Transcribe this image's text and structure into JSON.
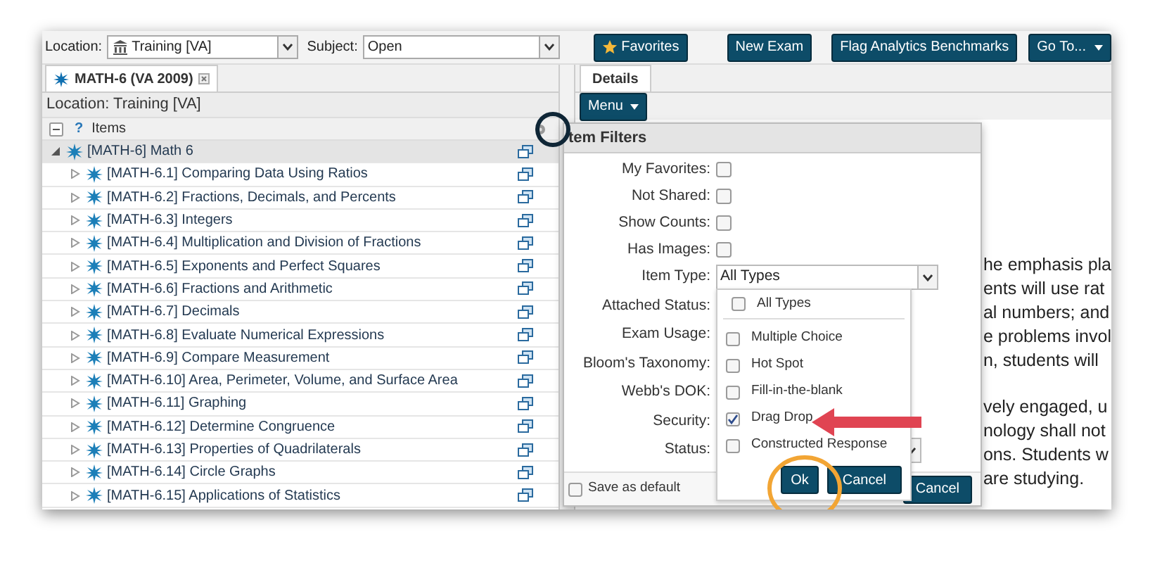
{
  "toolbar": {
    "location_label": "Location:",
    "location_value": "Training [VA]",
    "subject_label": "Subject:",
    "subject_value": "Open",
    "buttons": [
      {
        "label": "Favorites",
        "kind": "star"
      },
      {
        "label": "New Exam",
        "kind": "plain"
      },
      {
        "label": "Flag Analytics Benchmarks",
        "kind": "plain"
      },
      {
        "label": "Go To...",
        "kind": "menu"
      }
    ]
  },
  "left_tab": {
    "label": "MATH-6 (VA 2009)"
  },
  "location_text": "Location: Training [VA]",
  "items_header": {
    "help": "?",
    "label": "Items"
  },
  "tree": [
    {
      "label": "[MATH-6] Math 6",
      "expanded": true,
      "children": [
        {
          "label": "[MATH-6.1] Comparing Data Using Ratios",
          "expanded": false
        },
        {
          "label": "[MATH-6.2] Fractions, Decimals, and Percents",
          "expanded": false
        },
        {
          "label": "[MATH-6.3] Integers",
          "expanded": false
        },
        {
          "label": "[MATH-6.4] Multiplication and Division of Fractions",
          "expanded": false
        },
        {
          "label": "[MATH-6.5] Exponents and Perfect Squares",
          "expanded": false
        },
        {
          "label": "[MATH-6.6] Fractions and Arithmetic",
          "expanded": false
        },
        {
          "label": "[MATH-6.7] Decimals",
          "expanded": false
        },
        {
          "label": "[MATH-6.8] Evaluate Numerical Expressions",
          "expanded": false
        },
        {
          "label": "[MATH-6.9] Compare Measurement",
          "expanded": false
        },
        {
          "label": "[MATH-6.10] Area, Perimeter, Volume, and Surface Area",
          "expanded": false
        },
        {
          "label": "[MATH-6.11] Graphing",
          "expanded": false
        },
        {
          "label": "[MATH-6.12] Determine Congruence",
          "expanded": false
        },
        {
          "label": "[MATH-6.13] Properties of Quadrilaterals",
          "expanded": false
        },
        {
          "label": "[MATH-6.14] Circle Graphs",
          "expanded": false
        },
        {
          "label": "[MATH-6.15] Applications of Statistics",
          "expanded": false
        }
      ]
    }
  ],
  "right_tab": {
    "label": "Details"
  },
  "menu_button": "Menu",
  "details_paragraphs": [
    [
      "he emphasis pla",
      "ents will use rat",
      "al numbers; and",
      "e problems invol",
      "n, students will"
    ],
    [
      "vely engaged, u",
      "nology shall not",
      "ons. Students w",
      "are studying."
    ]
  ],
  "filters": {
    "title": "tem Filters",
    "fields": [
      {
        "label": "My Favorites:",
        "kind": "checkbox",
        "checked": false
      },
      {
        "label": "Not Shared:",
        "kind": "checkbox",
        "checked": false
      },
      {
        "label": "Show Counts:",
        "kind": "checkbox",
        "checked": false
      },
      {
        "label": "Has Images:",
        "kind": "checkbox",
        "checked": false
      },
      {
        "label": "Item Type:",
        "kind": "select",
        "value": "All Types"
      },
      {
        "label": "Attached Status:",
        "kind": "covered"
      },
      {
        "label": "Exam Usage:",
        "kind": "covered"
      },
      {
        "label": "Bloom's Taxonomy:",
        "kind": "covered"
      },
      {
        "label": "Webb's DOK:",
        "kind": "covered"
      },
      {
        "label": "Security:",
        "kind": "covered"
      },
      {
        "label": "Status:",
        "kind": "select"
      }
    ],
    "type_options": [
      {
        "label": "All Types",
        "checked": false
      },
      {
        "label": "Multiple Choice",
        "checked": false
      },
      {
        "label": "Hot Spot",
        "checked": false
      },
      {
        "label": "Fill-in-the-blank",
        "checked": false
      },
      {
        "label": "Drag Drop",
        "checked": true
      },
      {
        "label": "Constructed Response",
        "checked": false
      }
    ],
    "list_ok": "Ok",
    "list_cancel": "Cancel",
    "save_default": {
      "label": "Save as default",
      "checked": false
    },
    "cancel": "Cancel"
  }
}
